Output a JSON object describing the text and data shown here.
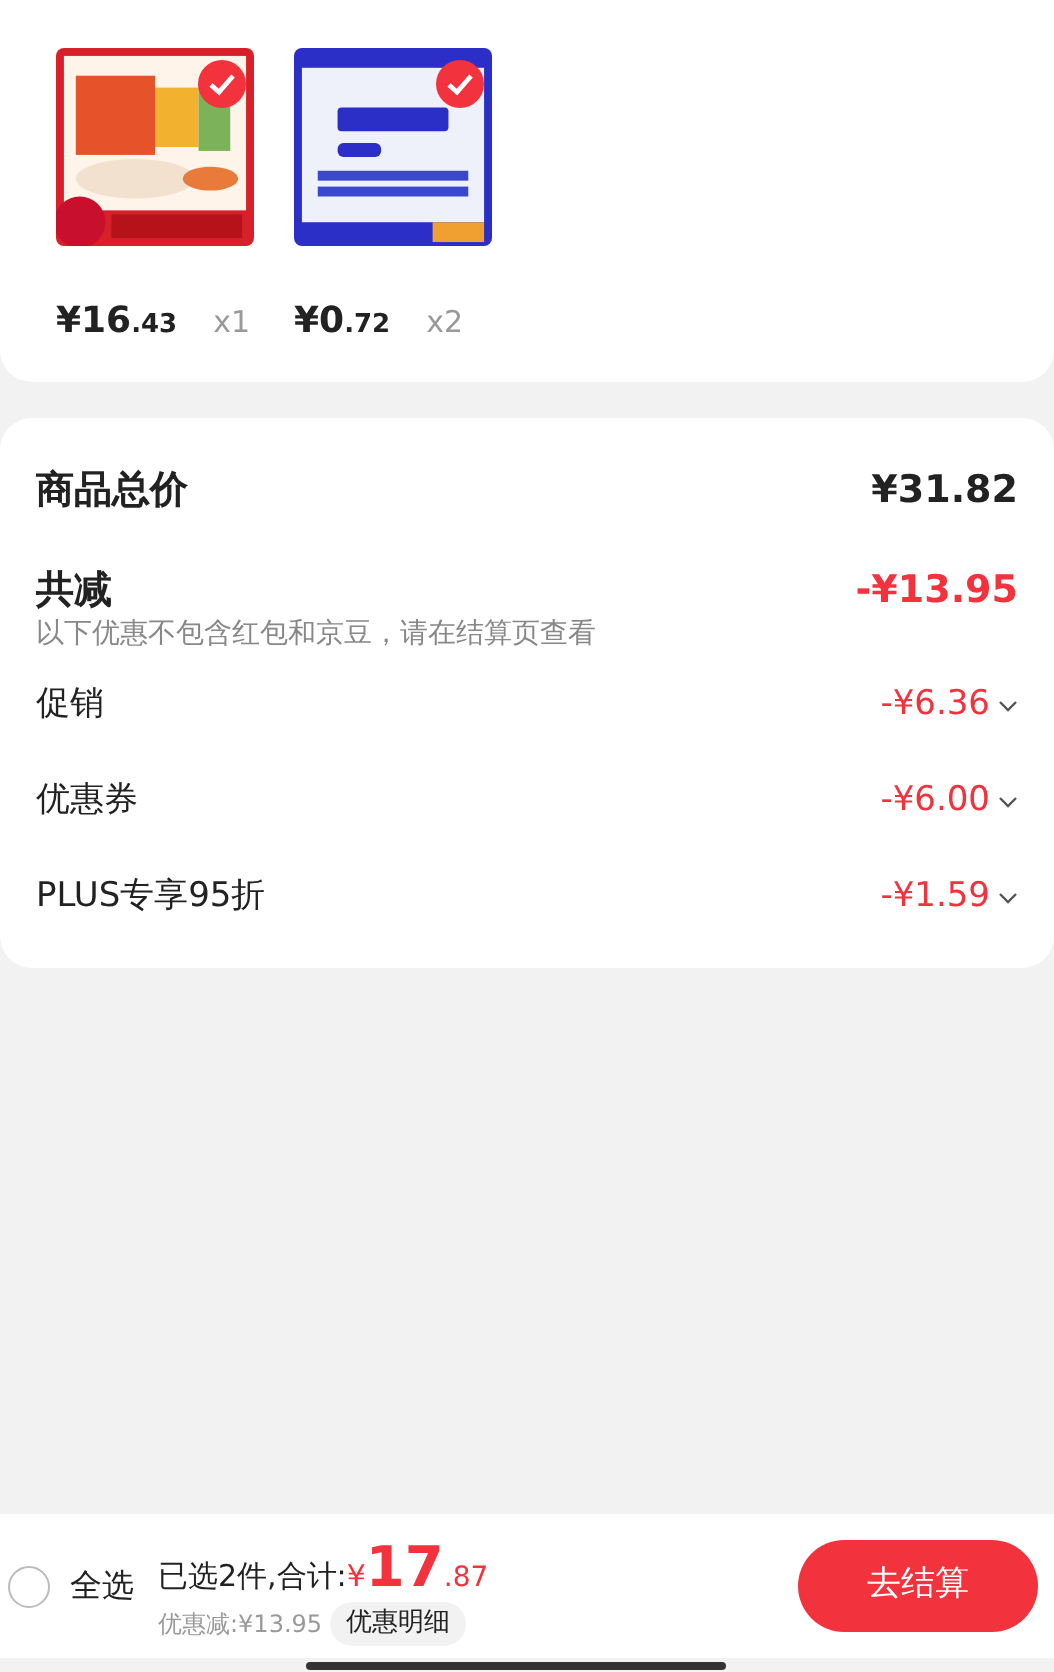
{
  "products": [
    {
      "kind": "picture",
      "selected": true,
      "price_main": "¥16",
      "price_decimal": ".43",
      "quantity": "x1"
    },
    {
      "kind": "picture",
      "selected": true,
      "price_main": "¥0",
      "price_decimal": ".72",
      "quantity": "x2"
    }
  ],
  "summary": {
    "total_label": "商品总价",
    "total_value": "¥31.82",
    "discount_label": "共减",
    "discount_value": "-¥13.95",
    "note": "以下优惠不包含红包和京豆，请在结算页查看",
    "items": [
      {
        "label": "促销",
        "value": "-¥6.36"
      },
      {
        "label": "优惠券",
        "value": "-¥6.00"
      },
      {
        "label": "PLUS专享95折",
        "value": "-¥1.59"
      }
    ]
  },
  "bottom_bar": {
    "select_all": {
      "label": "全选",
      "checked": false
    },
    "selected_text": "已选2件,合计:",
    "total_symbol": "¥",
    "total_main": "17",
    "total_decimal": ".87",
    "discount_text": "优惠减:¥13.95",
    "detail_button": "优惠明细",
    "checkout_button": "去结算"
  }
}
